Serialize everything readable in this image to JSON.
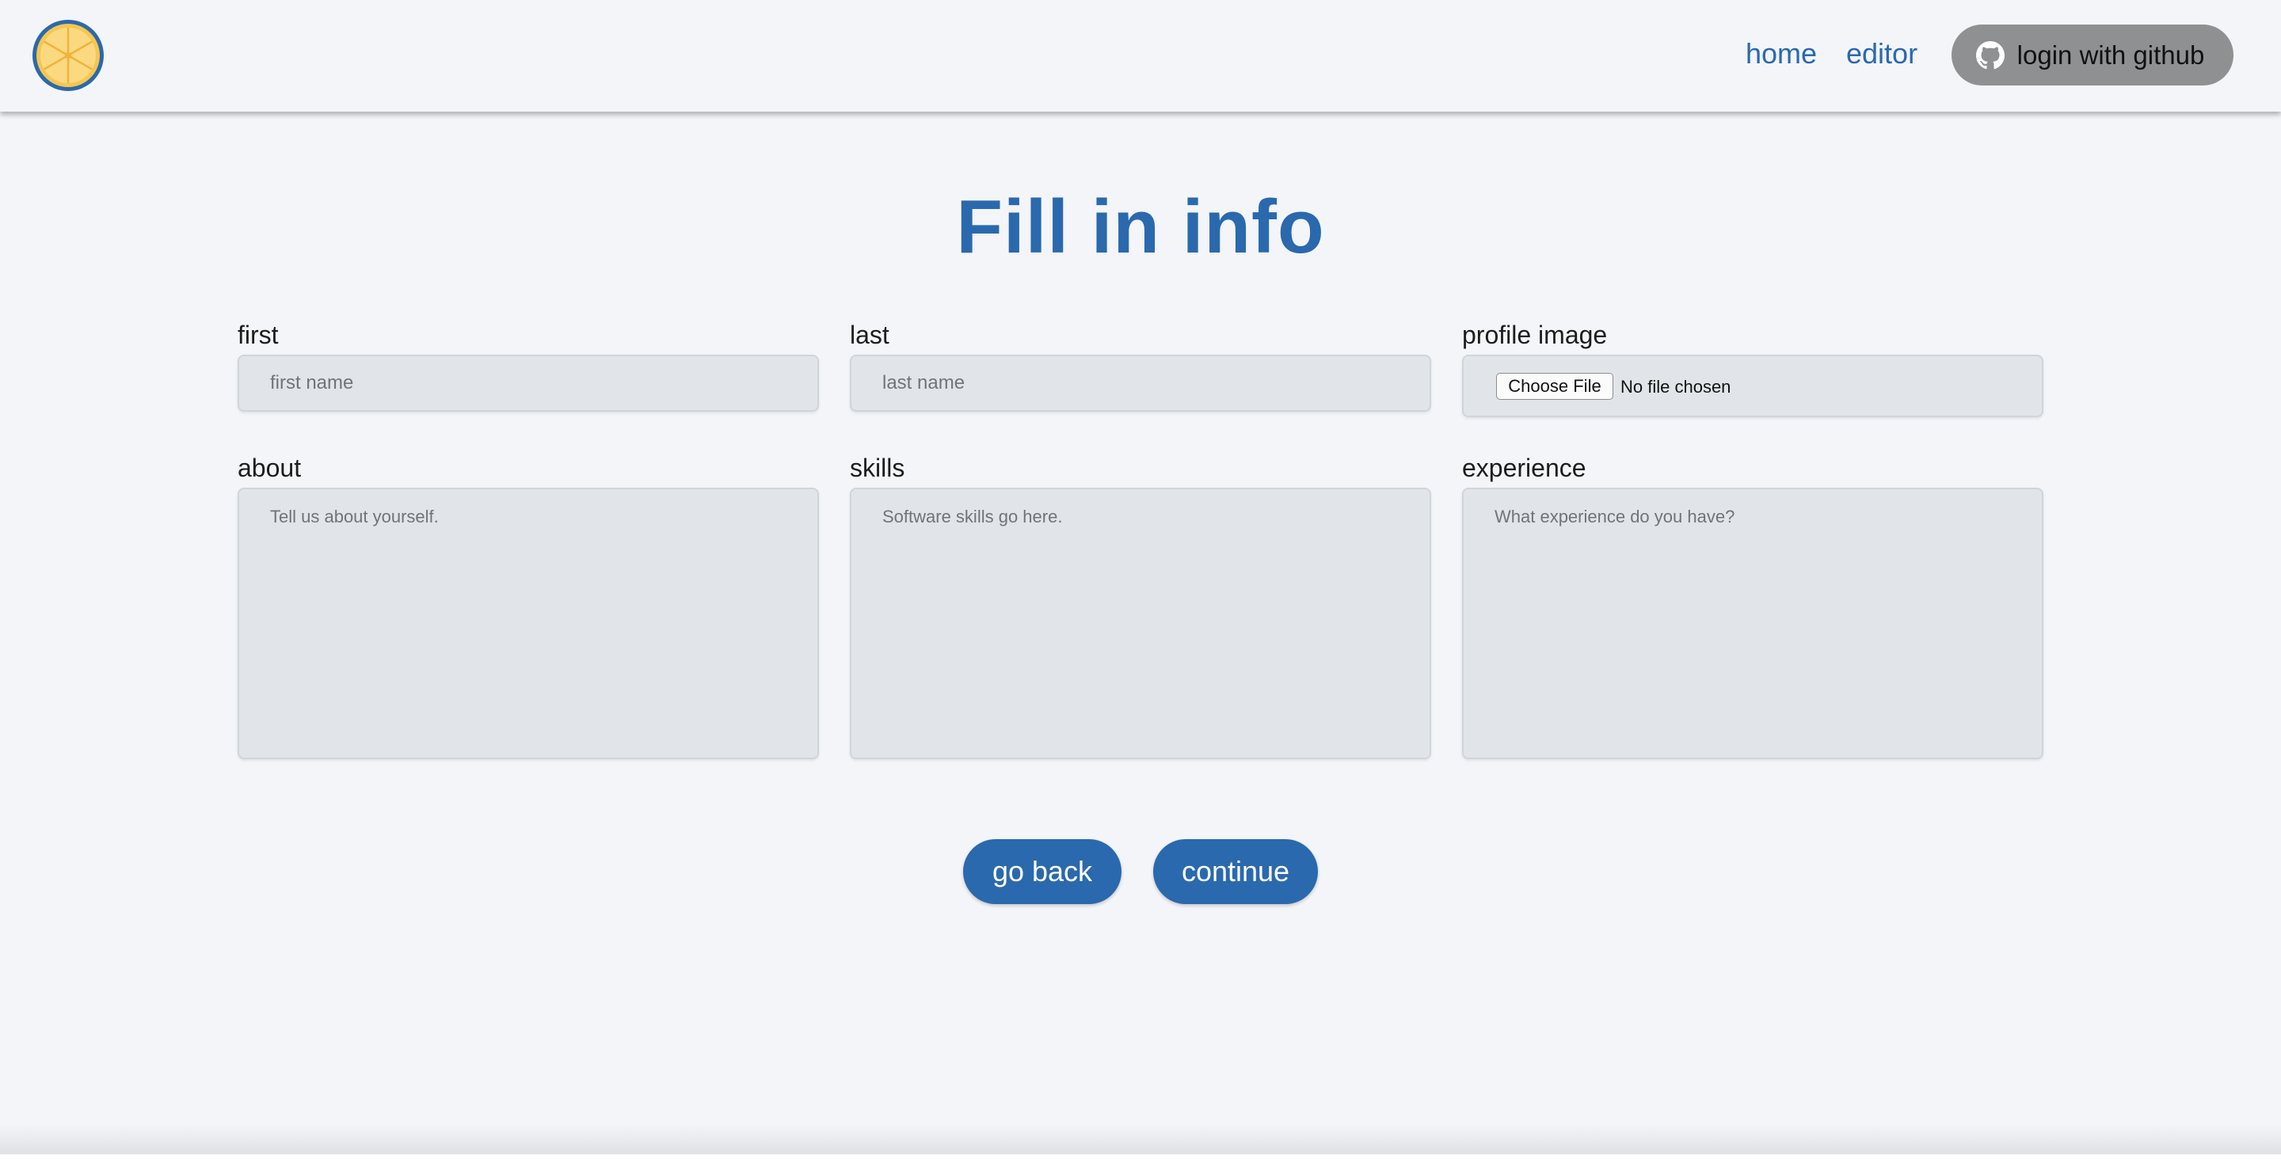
{
  "nav": {
    "home_label": "home",
    "editor_label": "editor",
    "github_button_label": "login with github",
    "logo_icon": "orange-slice-logo",
    "github_icon": "github-icon"
  },
  "main": {
    "title": "Fill in info"
  },
  "form": {
    "first": {
      "label": "first",
      "placeholder": "first name"
    },
    "last": {
      "label": "last",
      "placeholder": "last name"
    },
    "profile_image": {
      "label": "profile image",
      "button_label": "Choose File",
      "status": "No file chosen"
    },
    "about": {
      "label": "about",
      "placeholder": "Tell us about yourself."
    },
    "skills": {
      "label": "skills",
      "placeholder": "Software skills go here."
    },
    "experience": {
      "label": "experience",
      "placeholder": "What experience do you have?"
    }
  },
  "actions": {
    "back_label": "go back",
    "continue_label": "continue"
  },
  "colors": {
    "accent": "#2a69ad",
    "background": "#f3f5f9",
    "input_bg": "#e1e5e9",
    "github_button_bg": "#8f9092"
  }
}
